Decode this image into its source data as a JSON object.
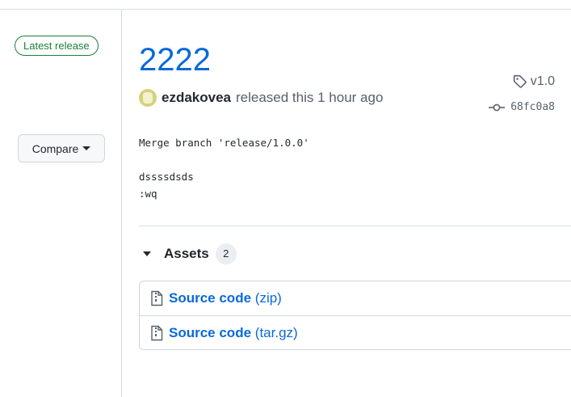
{
  "sidebar": {
    "latest_badge": "Latest release",
    "tag": "v1.0",
    "commit": "68fc0a8",
    "compare_label": "Compare"
  },
  "release": {
    "title": "2222",
    "author": "ezdakovea",
    "released_text": "released this 1 hour ago",
    "notes": [
      "Merge branch 'release/1.0.0'",
      "",
      "dssssdsds",
      ":wq"
    ]
  },
  "assets": {
    "label": "Assets",
    "count": "2",
    "items": [
      {
        "label": "Source code",
        "ext": "(zip)",
        "icon": "file-zip-icon"
      },
      {
        "label": "Source code",
        "ext": "(tar.gz)",
        "icon": "file-zip-icon"
      }
    ]
  },
  "colors": {
    "link": "#0969da",
    "success": "#1a7f37",
    "muted": "#57606a",
    "border": "#d0d7de"
  }
}
